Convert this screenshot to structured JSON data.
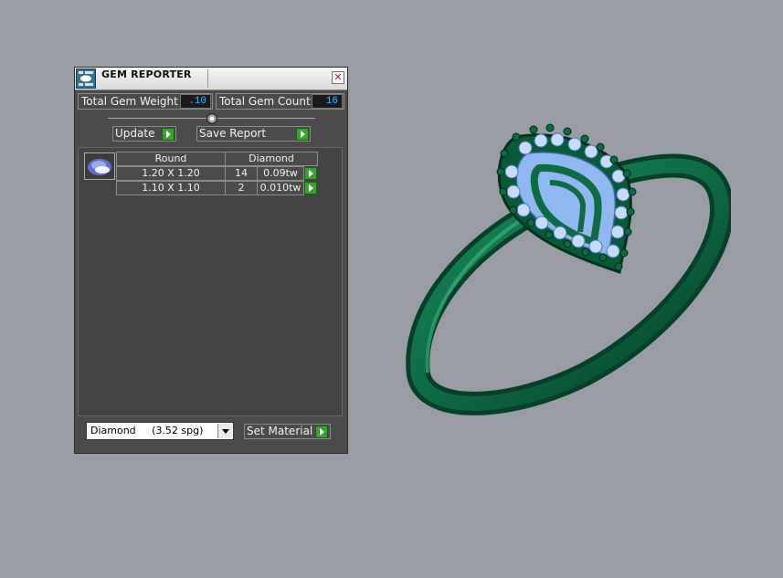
{
  "panel": {
    "title": "GEM REPORTER",
    "close_glyph": "✕",
    "total_gem_weight_label": "Total Gem Weight",
    "total_gem_weight_value": ".10",
    "total_gem_count_label": "Total Gem Count",
    "total_gem_count_value": "16",
    "update_label": "Update",
    "save_report_label": "Save Report"
  },
  "gem_table": {
    "shape": "Round",
    "material": "Diamond",
    "rows": [
      {
        "size": "1.20 X 1.20",
        "count": "14",
        "weight": "0.09tw"
      },
      {
        "size": "1.10 X 1.10",
        "count": "2",
        "weight": "0.010tw"
      }
    ]
  },
  "material_select": {
    "value": "Diamond     (3.52 spg)",
    "set_material_label": "Set Material"
  },
  "colors": {
    "viewport_bg": "#999da3",
    "panel_bg": "#4b4b4b",
    "value_text": "#39b8ff",
    "go_button": "#3da130",
    "ring_metal": "#0e6b45",
    "gem_blue": "#8fb7f0"
  },
  "icons": {
    "app": "gem-reporter-app-icon",
    "close": "close-icon",
    "go": "play-arrow-icon",
    "gem": "round-gem-icon",
    "dropdown": "chevron-down-icon"
  }
}
